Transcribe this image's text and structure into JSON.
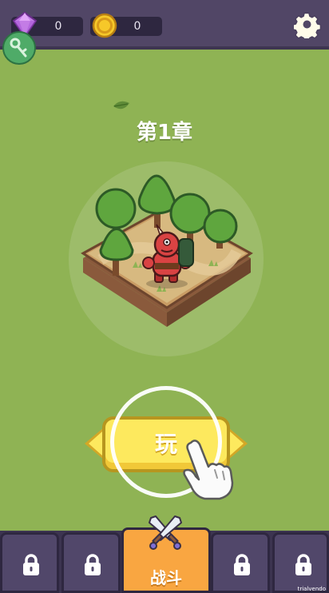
{
  "currency": {
    "gems": "0",
    "coins": "0"
  },
  "chapter": {
    "title": "第1章"
  },
  "play_button": {
    "label": "玩"
  },
  "bottom_nav": {
    "battle_label": "战斗",
    "locked_tabs": 4
  },
  "watermark": "trialvendo",
  "icons": {
    "gem": "gem-icon",
    "coin": "coin-icon",
    "settings": "gear-icon",
    "key": "key-icon",
    "lock": "lock-icon",
    "swords": "crossed-swords-icon",
    "hand": "pointing-hand-icon"
  },
  "colors": {
    "background": "#8fb354",
    "topbar": "#514666",
    "play_button": "#fde95e",
    "battle_tab": "#f9a641"
  }
}
